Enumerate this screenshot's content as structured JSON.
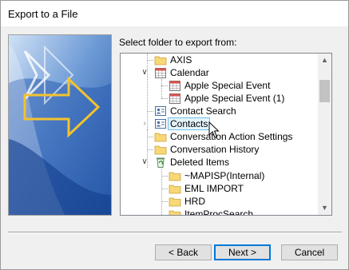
{
  "window": {
    "title": "Export to a File"
  },
  "folder_section": {
    "label": "Select folder to export from:"
  },
  "tree": {
    "items": [
      {
        "label": "AXIS",
        "icon": "folder-icon",
        "expander": "none"
      },
      {
        "label": "Calendar",
        "icon": "calendar-icon",
        "expander": "expanded"
      },
      {
        "label": "Apple Special Event",
        "icon": "calendar-icon",
        "expander": "none"
      },
      {
        "label": "Apple Special Event (1)",
        "icon": "calendar-icon",
        "expander": "none"
      },
      {
        "label": "Contact Search",
        "icon": "contacts-icon",
        "expander": "none"
      },
      {
        "label": "Contacts",
        "icon": "contacts-icon",
        "expander": "collapsed",
        "hovered": true
      },
      {
        "label": "Conversation Action Settings",
        "icon": "folder-icon",
        "expander": "none"
      },
      {
        "label": "Conversation History",
        "icon": "folder-icon",
        "expander": "none"
      },
      {
        "label": "Deleted Items",
        "icon": "recycle-icon",
        "expander": "expanded"
      },
      {
        "label": "~MAPISP(Internal)",
        "icon": "folder-icon",
        "expander": "none"
      },
      {
        "label": "EML IMPORT",
        "icon": "folder-icon",
        "expander": "none"
      },
      {
        "label": "HRD",
        "icon": "folder-icon",
        "expander": "none"
      },
      {
        "label": "ItemProcSearch",
        "icon": "folder-icon",
        "expander": "none"
      }
    ]
  },
  "buttons": {
    "back_label": "< Back",
    "next_label": "Next >",
    "cancel_label": "Cancel"
  },
  "colors": {
    "accent": "#0078d7",
    "folder": "#f8d775",
    "hover_bg": "#e5f3fb",
    "hover_border": "#70c0e7"
  }
}
